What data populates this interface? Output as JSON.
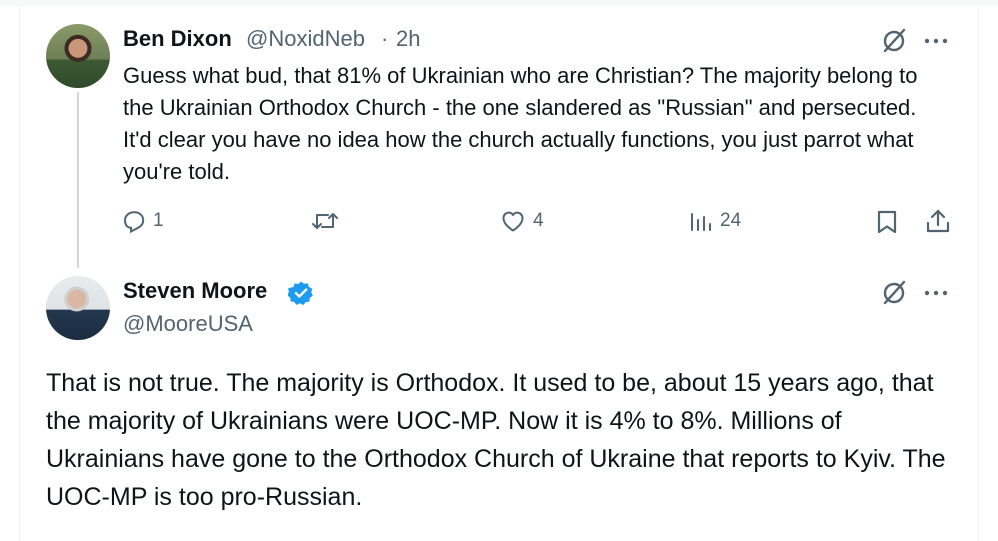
{
  "tweets": [
    {
      "name": "Ben Dixon",
      "handle": "@NoxidNeb",
      "separator": "·",
      "time": "2h",
      "text": "Guess what bud, that 81% of Ukrainian who are Christian? The majority belong to the Ukrainian Orthodox Church - the one slandered as \"Russian\" and persecuted. It'd clear you have no idea how the church actually functions, you just parrot what you're told.",
      "replies": "1",
      "likes": "4",
      "views": "24"
    },
    {
      "name": "Steven Moore",
      "handle": "@MooreUSA",
      "verified": true,
      "text": "That is not true. The majority is Orthodox. It used to be, about 15 years ago, that the majority of Ukrainians were UOC-MP. Now it is 4% to 8%. Millions of Ukrainians have gone to the Orthodox Church of Ukraine that reports to Kyiv. The UOC-MP is too pro-Russian."
    }
  ],
  "icons": {
    "grok": "grok-icon",
    "more": "more-icon",
    "reply": "reply-icon",
    "retweet": "retweet-icon",
    "like": "like-icon",
    "views": "views-icon",
    "bookmark": "bookmark-icon",
    "share": "share-icon",
    "verified": "verified-badge-icon"
  },
  "colors": {
    "text": "#0f1419",
    "secondary": "#536471",
    "verified": "#1d9bf0",
    "thread_line": "#cfd9de"
  }
}
